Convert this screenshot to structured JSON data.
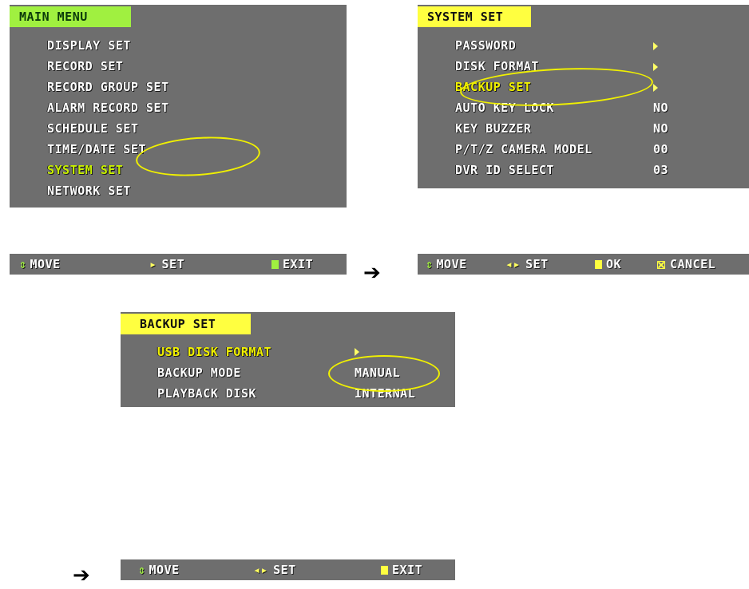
{
  "main_menu": {
    "title": "MAIN MENU",
    "items": [
      "DISPLAY SET",
      "RECORD SET",
      "RECORD GROUP SET",
      "ALARM RECORD SET",
      "SCHEDULE SET",
      "TIME/DATE SET",
      "SYSTEM SET",
      "NETWORK SET"
    ],
    "selected": "SYSTEM SET",
    "footer": {
      "move": "MOVE",
      "set": "SET",
      "exit": "EXIT"
    }
  },
  "system_set": {
    "title": "SYSTEM SET",
    "rows": [
      {
        "label": "PASSWORD",
        "value": "▸"
      },
      {
        "label": "DISK FORMAT",
        "value": "▸"
      },
      {
        "label": "BACKUP SET",
        "value": "▸"
      },
      {
        "label": "AUTO KEY LOCK",
        "value": "NO"
      },
      {
        "label": "KEY BUZZER",
        "value": "NO"
      },
      {
        "label": "P/T/Z CAMERA MODEL",
        "value": "00"
      },
      {
        "label": "DVR ID SELECT",
        "value": "03"
      }
    ],
    "selected": "BACKUP SET",
    "footer": {
      "move": "MOVE",
      "set": "SET",
      "ok": "OK",
      "cancel": "CANCEL"
    }
  },
  "backup_set": {
    "title": "BACKUP SET",
    "rows": [
      {
        "label": "USB DISK FORMAT",
        "value": "▸"
      },
      {
        "label": "BACKUP MODE",
        "value": "MANUAL"
      },
      {
        "label": "PLAYBACK DISK",
        "value": "INTERNAL"
      }
    ],
    "selected": "USB DISK FORMAT",
    "footer": {
      "move": "MOVE",
      "set": "SET",
      "exit": "EXIT"
    }
  },
  "arrows": {
    "symbol": "➔"
  },
  "colors": {
    "panel_bg": "#6e6e6e",
    "title_green": "#a0f040",
    "title_yellow": "#ffff40",
    "highlight": "#f0f000"
  }
}
